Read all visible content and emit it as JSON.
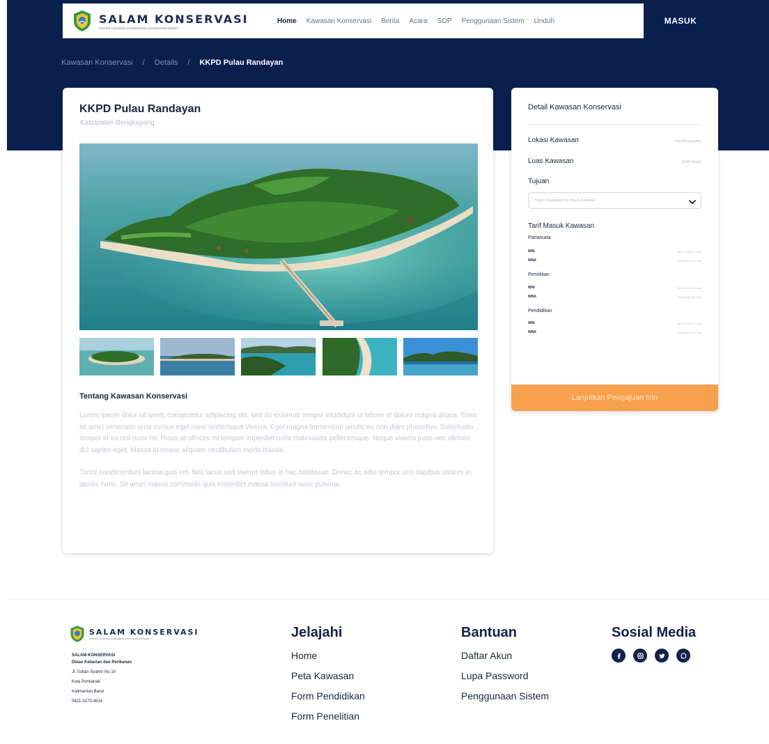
{
  "brand": {
    "name": "SALAM KONSERVASI",
    "tagline": "SISTEM LAYANAN KONSERVASI KALIMANTAN BARAT"
  },
  "nav": {
    "items": [
      {
        "label": "Home",
        "active": true
      },
      {
        "label": "Kawasan Konservasi",
        "active": false
      },
      {
        "label": "Berita",
        "active": false
      },
      {
        "label": "Acara",
        "active": false
      },
      {
        "label": "SOP",
        "active": false
      },
      {
        "label": "Penggunaan Sistem",
        "active": false
      },
      {
        "label": "Unduh",
        "active": false
      }
    ],
    "login_label": "MASUK"
  },
  "breadcrumb": {
    "items": [
      "Kawasan Konservasi",
      "Details",
      "KKPD Pulau Randayan"
    ],
    "separator": "/"
  },
  "main": {
    "title": "KKPD Pulau Randayan",
    "subtitle": "Kabupaten Bengkayang",
    "about_title": "Tentang Kawasan Konservasi",
    "paragraphs": [
      "Lorem ipsum dolor sit amet, consectetur adipiscing elit, sed do eiusmod tempor incididunt ut labore et dolore magna aliqua. Enim sit amet venenatis urna cursus eget nunc scelerisque viverra. Eget magna fermentum iaculis eu non diam phasellus. Sollicitudin tempor id eu nisl nunc mi. Risus at ultrices mi tempus imperdiet nulla malesuada pellentesque. Neque viverra justo nec ultrices dui sapien eget. Massa id neque aliquam vestibulum morbi blandit.",
      "Tortor condimentum lacinia quis vel. Nisi lacus sed viverra tellus in hac habitasse. Donec ac odio tempor orci dapibus ultrices in iaculis nunc. Sit amet mauris commodo quis imperdiet massa tincidunt nunc pulvinar."
    ],
    "thumbnails": [
      "thumbnail-1",
      "thumbnail-2",
      "thumbnail-3",
      "thumbnail-4",
      "thumbnail-5"
    ]
  },
  "detail": {
    "title": "Detail Kawasan Konservasi",
    "lokasi_label": "Lokasi Kawasan",
    "lokasi_value": "Kab Bengkayang",
    "luas_label": "Luas Kawasan",
    "luas_value": "3.645 Hektar",
    "tujuan_label": "Tujuan",
    "tujuan_placeholder": "Tujuan Pengajuan Izin Masuk Kawasan",
    "tarif_title": "Tarif Masuk Kawasan",
    "groups": [
      {
        "label": "Pariwisata",
        "items": [
          {
            "label": "WNI",
            "value": "Rp 10.000,00 / hari"
          },
          {
            "label": "WNA",
            "value": "Rp 50.000,00 / hari"
          }
        ]
      },
      {
        "label": "Penelitian",
        "items": [
          {
            "label": "WNI",
            "value": "Rp 10.000,00 / hari"
          },
          {
            "label": "WNA",
            "value": "Rp 50.000,00 / hari"
          }
        ]
      },
      {
        "label": "Pendidikan",
        "items": [
          {
            "label": "WNI",
            "value": "Rp 10.000,00 / hari"
          },
          {
            "label": "WNA",
            "value": "Rp 50.000,00 / hari"
          }
        ]
      }
    ],
    "cta_label": "Lanjutkan Pengajuan Izin"
  },
  "footer": {
    "address": {
      "org": "SALAM KONSERVASI",
      "dept": "Dinas Kelautan dan Perikanan",
      "street": "Jl. Sultan Syahrir No 10",
      "city": "Kota Pontianak",
      "province": "Kalimantan Barat",
      "phone": "0821-3173-4534"
    },
    "jelajahi": {
      "title": "Jelajahi",
      "links": [
        "Home",
        "Peta Kawasan",
        "Form Pendidikan",
        "Form Penelitian"
      ]
    },
    "bantuan": {
      "title": "Bantuan",
      "links": [
        "Daftar Akun",
        "Lupa Password",
        "Penggunaan Sistem"
      ]
    },
    "sosial": {
      "title": "Sosial Media",
      "icons": [
        "facebook-icon",
        "instagram-icon",
        "twitter-icon",
        "whatsapp-icon"
      ]
    }
  },
  "colors": {
    "navy": "#0a1f4e",
    "orange": "#f7a04d",
    "text": "#1b2540",
    "muted": "#c4c8d2"
  }
}
